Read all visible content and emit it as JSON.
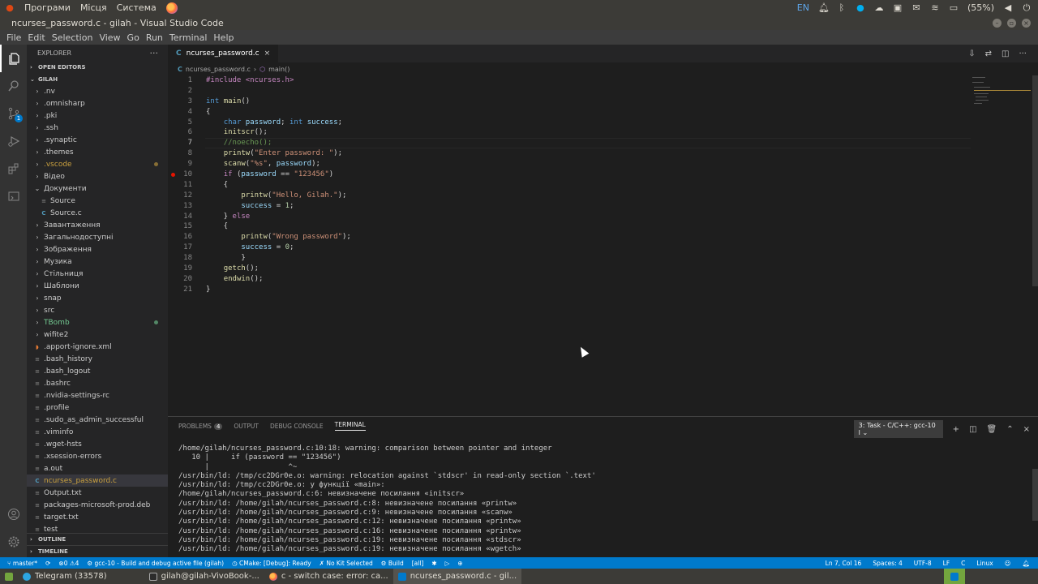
{
  "system_panel": {
    "menus": [
      "Програми",
      "Місця",
      "Система"
    ],
    "keyboard_layout": "EN",
    "battery": "(55%)",
    "icons": [
      "notification-bell-icon",
      "bluetooth-icon",
      "skype-icon",
      "cloud-icon",
      "nvidia-icon",
      "mail-icon",
      "wifi-icon",
      "battery-icon",
      "volume-icon",
      "power-icon"
    ]
  },
  "window": {
    "title": "ncurses_password.c - gilah - Visual Studio Code"
  },
  "menubar": [
    "File",
    "Edit",
    "Selection",
    "View",
    "Go",
    "Run",
    "Terminal",
    "Help"
  ],
  "activity_bar": [
    "explorer-icon",
    "search-icon",
    "source-control-icon",
    "run-debug-icon",
    "extensions-icon",
    "remote-explorer-icon",
    "accounts-icon",
    "settings-gear-icon"
  ],
  "activity_badge": "1",
  "explorer": {
    "title": "EXPLORER",
    "open_editors": "OPEN EDITORS",
    "root": "GILAH",
    "items": [
      {
        "label": ".nv",
        "type": "folder",
        "indent": 1,
        "color": "#cccccc",
        "dot": false,
        "open": false
      },
      {
        "label": ".omnisharp",
        "type": "folder",
        "indent": 1,
        "color": "#cccccc",
        "dot": false,
        "open": false
      },
      {
        "label": ".pki",
        "type": "folder",
        "indent": 1,
        "color": "#cccccc",
        "dot": false,
        "open": false
      },
      {
        "label": ".ssh",
        "type": "folder",
        "indent": 1,
        "color": "#cccccc",
        "dot": false,
        "open": false
      },
      {
        "label": ".synaptic",
        "type": "folder",
        "indent": 1,
        "color": "#cccccc",
        "dot": false,
        "open": false
      },
      {
        "label": ".themes",
        "type": "folder",
        "indent": 1,
        "color": "#cccccc",
        "dot": false,
        "open": false
      },
      {
        "label": ".vscode",
        "type": "folder",
        "indent": 1,
        "color": "#c9a03f",
        "dot": true,
        "open": false
      },
      {
        "label": "Відео",
        "type": "folder",
        "indent": 1,
        "color": "#cccccc",
        "dot": false,
        "open": false
      },
      {
        "label": "Документи",
        "type": "folder",
        "indent": 1,
        "color": "#cccccc",
        "dot": false,
        "open": true
      },
      {
        "label": "Source",
        "type": "file-plain",
        "indent": 2,
        "color": "#cccccc",
        "dot": false,
        "open": false
      },
      {
        "label": "Source.c",
        "type": "file-c",
        "indent": 2,
        "color": "#cccccc",
        "dot": false,
        "open": false
      },
      {
        "label": "Завантаження",
        "type": "folder",
        "indent": 1,
        "color": "#cccccc",
        "dot": false,
        "open": false
      },
      {
        "label": "Загальнодоступні",
        "type": "folder",
        "indent": 1,
        "color": "#cccccc",
        "dot": false,
        "open": false
      },
      {
        "label": "Зображення",
        "type": "folder",
        "indent": 1,
        "color": "#cccccc",
        "dot": false,
        "open": false
      },
      {
        "label": "Музика",
        "type": "folder",
        "indent": 1,
        "color": "#cccccc",
        "dot": false,
        "open": false
      },
      {
        "label": "Стільниця",
        "type": "folder",
        "indent": 1,
        "color": "#cccccc",
        "dot": false,
        "open": false
      },
      {
        "label": "Шаблони",
        "type": "folder",
        "indent": 1,
        "color": "#cccccc",
        "dot": false,
        "open": false
      },
      {
        "label": "snap",
        "type": "folder",
        "indent": 1,
        "color": "#cccccc",
        "dot": false,
        "open": false
      },
      {
        "label": "src",
        "type": "folder",
        "indent": 1,
        "color": "#cccccc",
        "dot": false,
        "open": false
      },
      {
        "label": "TBomb",
        "type": "folder",
        "indent": 1,
        "color": "#73c991",
        "dot": true,
        "open": false
      },
      {
        "label": "wifite2",
        "type": "folder",
        "indent": 1,
        "color": "#cccccc",
        "dot": false,
        "open": false
      },
      {
        "label": ".apport-ignore.xml",
        "type": "file-xml",
        "indent": 1,
        "color": "#cccccc",
        "dot": false,
        "open": false
      },
      {
        "label": ".bash_history",
        "type": "file-plain",
        "indent": 1,
        "color": "#cccccc",
        "dot": false,
        "open": false
      },
      {
        "label": ".bash_logout",
        "type": "file-plain",
        "indent": 1,
        "color": "#cccccc",
        "dot": false,
        "open": false
      },
      {
        "label": ".bashrc",
        "type": "file-plain",
        "indent": 1,
        "color": "#cccccc",
        "dot": false,
        "open": false
      },
      {
        "label": ".nvidia-settings-rc",
        "type": "file-plain",
        "indent": 1,
        "color": "#cccccc",
        "dot": false,
        "open": false
      },
      {
        "label": ".profile",
        "type": "file-plain",
        "indent": 1,
        "color": "#cccccc",
        "dot": false,
        "open": false
      },
      {
        "label": ".sudo_as_admin_successful",
        "type": "file-plain",
        "indent": 1,
        "color": "#cccccc",
        "dot": false,
        "open": false
      },
      {
        "label": ".viminfo",
        "type": "file-plain",
        "indent": 1,
        "color": "#cccccc",
        "dot": false,
        "open": false
      },
      {
        "label": ".wget-hsts",
        "type": "file-plain",
        "indent": 1,
        "color": "#cccccc",
        "dot": false,
        "open": false
      },
      {
        "label": ".xsession-errors",
        "type": "file-plain",
        "indent": 1,
        "color": "#cccccc",
        "dot": false,
        "open": false
      },
      {
        "label": "a.out",
        "type": "file-plain",
        "indent": 1,
        "color": "#cccccc",
        "dot": false,
        "open": false
      },
      {
        "label": "ncurses_password.c",
        "type": "file-c",
        "indent": 1,
        "color": "#c9a03f",
        "dot": false,
        "open": false,
        "selected": true
      },
      {
        "label": "Output.txt",
        "type": "file-plain",
        "indent": 1,
        "color": "#cccccc",
        "dot": false,
        "open": false
      },
      {
        "label": "packages-microsoft-prod.deb",
        "type": "file-plain",
        "indent": 1,
        "color": "#cccccc",
        "dot": false,
        "open": false
      },
      {
        "label": "target.txt",
        "type": "file-plain",
        "indent": 1,
        "color": "#cccccc",
        "dot": false,
        "open": false
      },
      {
        "label": "test",
        "type": "file-plain",
        "indent": 1,
        "color": "#cccccc",
        "dot": false,
        "open": false
      }
    ],
    "outline": "OUTLINE",
    "timeline": "TIMELINE"
  },
  "editor": {
    "tab_label": "ncurses_password.c",
    "breadcrumb_file": "ncurses_password.c",
    "breadcrumb_symbol": "main()",
    "current_line": 7,
    "breakpoint_line": 10,
    "lines": [
      [
        {
          "t": "#include <ncurses.h>",
          "c": "pp"
        }
      ],
      [],
      [
        {
          "t": "int",
          "c": "k"
        },
        {
          "t": " "
        },
        {
          "t": "main",
          "c": "f"
        },
        {
          "t": "()"
        }
      ],
      [
        {
          "t": "{"
        }
      ],
      [
        {
          "t": "    "
        },
        {
          "t": "char",
          "c": "k"
        },
        {
          "t": " "
        },
        {
          "t": "password",
          "c": "v"
        },
        {
          "t": "; "
        },
        {
          "t": "int",
          "c": "k"
        },
        {
          "t": " "
        },
        {
          "t": "success",
          "c": "v"
        },
        {
          "t": ";"
        }
      ],
      [
        {
          "t": "    "
        },
        {
          "t": "initscr",
          "c": "f"
        },
        {
          "t": "();"
        }
      ],
      [
        {
          "t": "    "
        },
        {
          "t": "//noecho();",
          "c": "c"
        }
      ],
      [
        {
          "t": "    "
        },
        {
          "t": "printw",
          "c": "f"
        },
        {
          "t": "("
        },
        {
          "t": "\"Enter password: \"",
          "c": "s"
        },
        {
          "t": ");"
        }
      ],
      [
        {
          "t": "    "
        },
        {
          "t": "scanw",
          "c": "f"
        },
        {
          "t": "("
        },
        {
          "t": "\"%s\"",
          "c": "s"
        },
        {
          "t": ", "
        },
        {
          "t": "password",
          "c": "v"
        },
        {
          "t": ");"
        }
      ],
      [
        {
          "t": "    "
        },
        {
          "t": "if",
          "c": "pp"
        },
        {
          "t": " ("
        },
        {
          "t": "password",
          "c": "v"
        },
        {
          "t": " == "
        },
        {
          "t": "\"123456\"",
          "c": "s"
        },
        {
          "t": ")"
        }
      ],
      [
        {
          "t": "    {"
        }
      ],
      [
        {
          "t": "        "
        },
        {
          "t": "printw",
          "c": "f"
        },
        {
          "t": "("
        },
        {
          "t": "\"Hello, Gilah.\"",
          "c": "s"
        },
        {
          "t": ");"
        }
      ],
      [
        {
          "t": "        "
        },
        {
          "t": "success",
          "c": "v"
        },
        {
          "t": " = "
        },
        {
          "t": "1",
          "c": "n"
        },
        {
          "t": ";"
        }
      ],
      [
        {
          "t": "    } "
        },
        {
          "t": "else",
          "c": "pp"
        }
      ],
      [
        {
          "t": "    {"
        }
      ],
      [
        {
          "t": "        "
        },
        {
          "t": "printw",
          "c": "f"
        },
        {
          "t": "("
        },
        {
          "t": "\"Wrong password\"",
          "c": "s"
        },
        {
          "t": ");"
        }
      ],
      [
        {
          "t": "        "
        },
        {
          "t": "success",
          "c": "v"
        },
        {
          "t": " = "
        },
        {
          "t": "0",
          "c": "n"
        },
        {
          "t": ";"
        }
      ],
      [
        {
          "t": "        }"
        }
      ],
      [
        {
          "t": "    "
        },
        {
          "t": "getch",
          "c": "f"
        },
        {
          "t": "();"
        }
      ],
      [
        {
          "t": "    "
        },
        {
          "t": "endwin",
          "c": "f"
        },
        {
          "t": "();"
        }
      ],
      [
        {
          "t": "}"
        }
      ]
    ]
  },
  "panel": {
    "tabs": [
      {
        "label": "PROBLEMS",
        "badge": "4",
        "active": false
      },
      {
        "label": "OUTPUT",
        "active": false
      },
      {
        "label": "DEBUG CONSOLE",
        "active": false
      },
      {
        "label": "TERMINAL",
        "active": true
      }
    ],
    "task_select": "3: Task - C/C++: gcc-10 l",
    "terminal_lines": [
      "/home/gilah/ncurses_password.c:10:18: warning: comparison between pointer and integer",
      "   10 |     if (password == \"123456\")",
      "      |                  ^~",
      "/usr/bin/ld: /tmp/cc2DGr0e.o: warning: relocation against `stdscr' in read-only section `.text'",
      "/usr/bin/ld: /tmp/cc2DGr0e.o: у функції «main»:",
      "/home/gilah/ncurses_password.c:6: невизначене посилання «initscr»",
      "/usr/bin/ld: /home/gilah/ncurses_password.c:8: невизначене посилання «printw»",
      "/usr/bin/ld: /home/gilah/ncurses_password.c:9: невизначене посилання «scanw»",
      "/usr/bin/ld: /home/gilah/ncurses_password.c:12: невизначене посилання «printw»",
      "/usr/bin/ld: /home/gilah/ncurses_password.c:16: невизначене посилання «printw»",
      "/usr/bin/ld: /home/gilah/ncurses_password.c:19: невизначене посилання «stdscr»",
      "/usr/bin/ld: /home/gilah/ncurses_password.c:19: невизначене посилання «wgetch»"
    ]
  },
  "statusbar": {
    "branch": "master*",
    "errors": "0",
    "warnings": "4",
    "task": "gcc-10 - Build and debug active file (gilah)",
    "cmake": "CMake: [Debug]: Ready",
    "kit": "No Kit Selected",
    "build": "Build",
    "target": "[all]",
    "position": "Ln 7, Col 16",
    "spaces": "Spaces: 4",
    "encoding": "UTF-8",
    "eol": "LF",
    "language_mode": "C",
    "platform": "Linux"
  },
  "taskbar": {
    "items": [
      {
        "label": "Telegram (33578)",
        "icon_color": "#2ca5e0",
        "active": false
      },
      {
        "label": "gilah@gilah-VivoBook-...",
        "icon_color": "#2c2c2c",
        "active": false
      },
      {
        "label": "c - switch case: error: ca...",
        "icon_color": "#ff7139",
        "active": false
      },
      {
        "label": "ncurses_password.c - gil...",
        "icon_color": "#007acc",
        "active": true
      }
    ]
  }
}
